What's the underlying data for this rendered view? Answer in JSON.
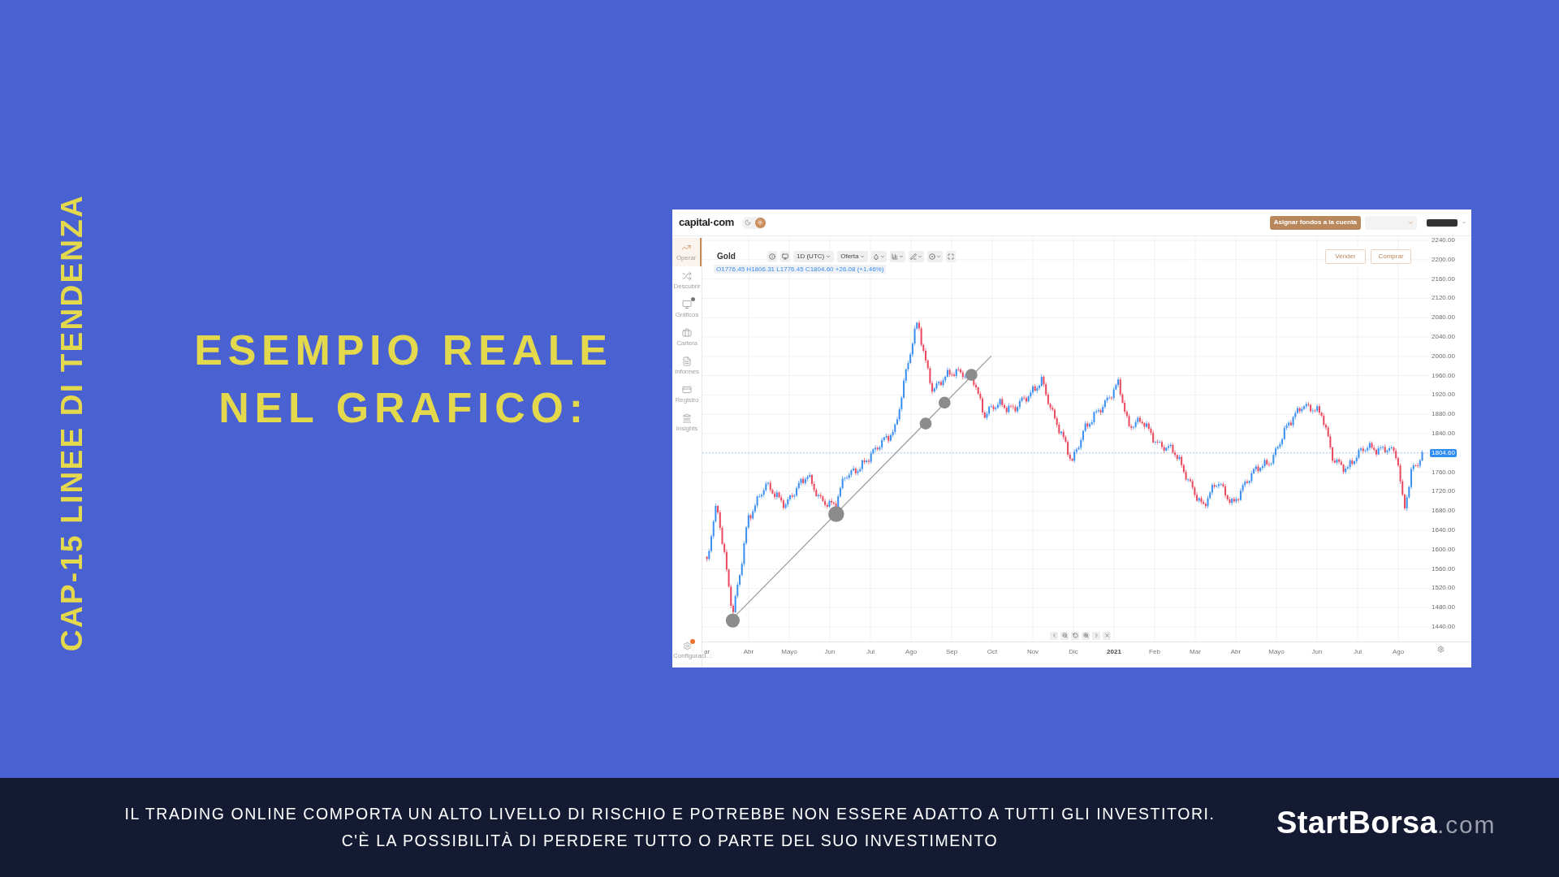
{
  "side_title": "CAP-15 LINEE DI TENDENZA",
  "heading": [
    "ESEMPIO REALE",
    "NEL GRAFICO:"
  ],
  "app_screenshot": {
    "top_bar": {
      "logo": "capital·com",
      "theme_options": [
        {
          "kind": "dark",
          "selected": false
        },
        {
          "kind": "light",
          "selected": true
        }
      ],
      "fund_button": "Asignar fondos a la cuenta"
    },
    "sidebar": {
      "items": [
        {
          "label": "Operar",
          "selected": true,
          "badge": false
        },
        {
          "label": "Descubrir",
          "selected": false,
          "badge": false
        },
        {
          "label": "Gráficos",
          "selected": false,
          "badge": true
        },
        {
          "label": "Cartera",
          "selected": false,
          "badge": false
        },
        {
          "label": "Informes",
          "selected": false,
          "badge": false
        },
        {
          "label": "Registro",
          "selected": false,
          "badge": false
        },
        {
          "label": "Insights",
          "selected": false,
          "badge": false
        }
      ],
      "settings": {
        "label": "Configuraci…",
        "badge": true
      }
    },
    "chart": {
      "instrument": "Gold",
      "timeframe": "1D (UTC)",
      "price_type": "Oferta",
      "ohlc": "O1776.45 H1806.31 L1776.45 C1804.60 +26.08 (+1.46%)",
      "sell_button": "Vender",
      "buy_button": "Comprar",
      "y_axis": [
        {
          "kind": "tick",
          "label": "2240.00"
        },
        {
          "kind": "tick",
          "label": "2200.00"
        },
        {
          "kind": "tick",
          "label": "2160.00"
        },
        {
          "kind": "tick",
          "label": "2120.00"
        },
        {
          "kind": "tick",
          "label": "2080.00"
        },
        {
          "kind": "tick",
          "label": "2040.00"
        },
        {
          "kind": "tick",
          "label": "2000.00"
        },
        {
          "kind": "tick",
          "label": "1960.00"
        },
        {
          "kind": "tick",
          "label": "1920.00"
        },
        {
          "kind": "tick",
          "label": "1880.00"
        },
        {
          "kind": "tick",
          "label": "1840.00"
        },
        {
          "kind": "price",
          "label": "1804.60"
        },
        {
          "kind": "tick",
          "label": "1760.00"
        },
        {
          "kind": "tick",
          "label": "1720.00"
        },
        {
          "kind": "tick",
          "label": "1680.00"
        },
        {
          "kind": "tick",
          "label": "1640.00"
        },
        {
          "kind": "tick",
          "label": "1600.00"
        },
        {
          "kind": "tick",
          "label": "1560.00"
        },
        {
          "kind": "tick",
          "label": "1520.00"
        },
        {
          "kind": "tick",
          "label": "1480.00"
        },
        {
          "kind": "tick",
          "label": "1440.00"
        }
      ],
      "x_axis": [
        {
          "kind": "month",
          "label": "ar"
        },
        {
          "kind": "month",
          "label": "Abr"
        },
        {
          "kind": "month",
          "label": "Mayo"
        },
        {
          "kind": "month",
          "label": "Jun"
        },
        {
          "kind": "month",
          "label": "Jul"
        },
        {
          "kind": "month",
          "label": "Ago"
        },
        {
          "kind": "month",
          "label": "Sep"
        },
        {
          "kind": "month",
          "label": "Oct"
        },
        {
          "kind": "month",
          "label": "Nov"
        },
        {
          "kind": "month",
          "label": "Dic"
        },
        {
          "kind": "year",
          "label": "2021"
        },
        {
          "kind": "month",
          "label": "Feb"
        },
        {
          "kind": "month",
          "label": "Mar"
        },
        {
          "kind": "month",
          "label": "Abr"
        },
        {
          "kind": "month",
          "label": "Mayo"
        },
        {
          "kind": "month",
          "label": "Jun"
        },
        {
          "kind": "month",
          "label": "Jul"
        },
        {
          "kind": "month",
          "label": "Ago"
        }
      ]
    }
  },
  "footer": {
    "disclaimer": [
      "IL TRADING ONLINE COMPORTA UN ALTO LIVELLO DI RISCHIO E POTREBBE NON ESSERE ADATTO A TUTTI GLI INVESTITORI.",
      "C'È LA POSSIBILITÀ DI PERDERE TUTTO O PARTE DEL SUO INVESTIMENTO"
    ],
    "brand": {
      "name": "StartBorsa",
      "domain": ".com"
    }
  }
}
